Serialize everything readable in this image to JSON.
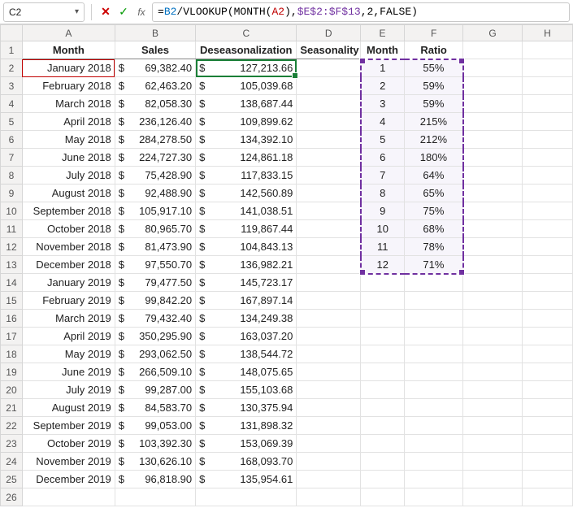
{
  "namebox": "C2",
  "formula": {
    "text": "=B2/VLOOKUP(MONTH(A2),$E$2:$F$13,2,FALSE)",
    "tokens": [
      {
        "t": "=",
        "c": "tok-black"
      },
      {
        "t": "B2",
        "c": "tok-blue"
      },
      {
        "t": "/VLOOKUP(MONTH(",
        "c": "tok-black"
      },
      {
        "t": "A2",
        "c": "tok-red"
      },
      {
        "t": ")",
        "c": "tok-black"
      },
      {
        "t": ",",
        "c": "tok-black"
      },
      {
        "t": "$E$2:$F$13",
        "c": "tok-purple"
      },
      {
        "t": ",",
        "c": "tok-black"
      },
      {
        "t": "2",
        "c": "tok-black"
      },
      {
        "t": ",",
        "c": "tok-black"
      },
      {
        "t": "FALSE",
        "c": "tok-black"
      },
      {
        "t": ")",
        "c": "tok-black"
      }
    ]
  },
  "cols": [
    "A",
    "B",
    "C",
    "D",
    "E",
    "F",
    "G",
    "H"
  ],
  "headers": {
    "A": "Month",
    "B": "Sales",
    "C": "Deseasonalization",
    "D": "Seasonality",
    "E": "Month",
    "F": "Ratio"
  },
  "rows": [
    {
      "n": 1
    },
    {
      "n": 2,
      "A": "January 2018",
      "B": "69,382.40",
      "C": "127,213.66",
      "E": "1",
      "F": "55%"
    },
    {
      "n": 3,
      "A": "February 2018",
      "B": "62,463.20",
      "C": "105,039.68",
      "E": "2",
      "F": "59%"
    },
    {
      "n": 4,
      "A": "March 2018",
      "B": "82,058.30",
      "C": "138,687.44",
      "E": "3",
      "F": "59%"
    },
    {
      "n": 5,
      "A": "April 2018",
      "B": "236,126.40",
      "C": "109,899.62",
      "E": "4",
      "F": "215%"
    },
    {
      "n": 6,
      "A": "May 2018",
      "B": "284,278.50",
      "C": "134,392.10",
      "E": "5",
      "F": "212%"
    },
    {
      "n": 7,
      "A": "June 2018",
      "B": "224,727.30",
      "C": "124,861.18",
      "E": "6",
      "F": "180%"
    },
    {
      "n": 8,
      "A": "July 2018",
      "B": "75,428.90",
      "C": "117,833.15",
      "E": "7",
      "F": "64%"
    },
    {
      "n": 9,
      "A": "August 2018",
      "B": "92,488.90",
      "C": "142,560.89",
      "E": "8",
      "F": "65%"
    },
    {
      "n": 10,
      "A": "September 2018",
      "B": "105,917.10",
      "C": "141,038.51",
      "E": "9",
      "F": "75%"
    },
    {
      "n": 11,
      "A": "October 2018",
      "B": "80,965.70",
      "C": "119,867.44",
      "E": "10",
      "F": "68%"
    },
    {
      "n": 12,
      "A": "November 2018",
      "B": "81,473.90",
      "C": "104,843.13",
      "E": "11",
      "F": "78%"
    },
    {
      "n": 13,
      "A": "December 2018",
      "B": "97,550.70",
      "C": "136,982.21",
      "E": "12",
      "F": "71%"
    },
    {
      "n": 14,
      "A": "January 2019",
      "B": "79,477.50",
      "C": "145,723.17"
    },
    {
      "n": 15,
      "A": "February 2019",
      "B": "99,842.20",
      "C": "167,897.14"
    },
    {
      "n": 16,
      "A": "March 2019",
      "B": "79,432.40",
      "C": "134,249.38"
    },
    {
      "n": 17,
      "A": "April 2019",
      "B": "350,295.90",
      "C": "163,037.20"
    },
    {
      "n": 18,
      "A": "May 2019",
      "B": "293,062.50",
      "C": "138,544.72"
    },
    {
      "n": 19,
      "A": "June 2019",
      "B": "266,509.10",
      "C": "148,075.65"
    },
    {
      "n": 20,
      "A": "July 2019",
      "B": "99,287.00",
      "C": "155,103.68"
    },
    {
      "n": 21,
      "A": "August 2019",
      "B": "84,583.70",
      "C": "130,375.94"
    },
    {
      "n": 22,
      "A": "September 2019",
      "B": "99,053.00",
      "C": "131,898.32"
    },
    {
      "n": 23,
      "A": "October 2019",
      "B": "103,392.30",
      "C": "153,069.39"
    },
    {
      "n": 24,
      "A": "November 2019",
      "B": "130,626.10",
      "C": "168,093.70"
    },
    {
      "n": 25,
      "A": "December 2019",
      "B": "96,818.90",
      "C": "135,954.61"
    },
    {
      "n": 26
    }
  ]
}
